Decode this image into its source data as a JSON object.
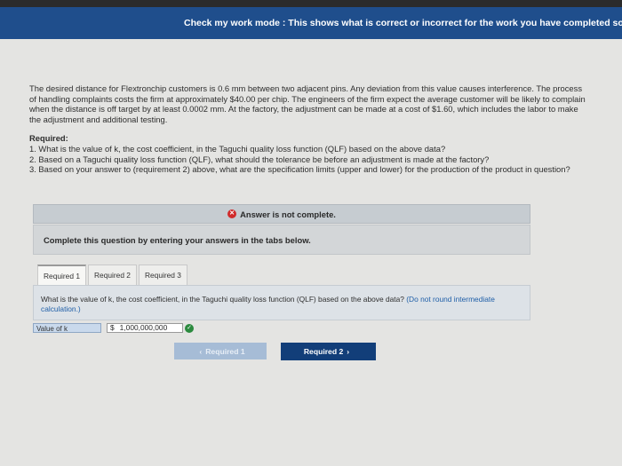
{
  "banner": {
    "text": "Check my work mode : This shows what is correct or incorrect for the work you have completed so far."
  },
  "problem": {
    "paragraph": "The desired distance for Flextronchip customers is 0.6 mm between two adjacent pins. Any deviation from this value causes interference. The process of handling complaints costs the firm at approximately $40.00 per chip. The engineers of the firm expect the average customer will be likely to complain when the distance is off target by at least 0.0002 mm. At the factory, the adjustment can be made at a cost of $1.60, which includes the labor to make the adjustment and additional testing.",
    "required_heading": "Required:",
    "requirements": [
      "1. What is the value of k, the cost coefficient, in the Taguchi quality loss function (QLF) based on the above data?",
      "2. Based on a Taguchi quality loss function (QLF), what should the tolerance be before an adjustment is made at the factory?",
      "3. Based on your answer to (requirement 2) above, what are the specification limits (upper and lower) for the production of the product in question?"
    ]
  },
  "status": {
    "text": "Answer is not complete.",
    "icon": "x-circle-icon",
    "color": "#d02b2b"
  },
  "instruction": {
    "text": "Complete this question by entering your answers in the tabs below."
  },
  "tabs": [
    {
      "label": "Required 1",
      "active": true
    },
    {
      "label": "Required 2",
      "active": false
    },
    {
      "label": "Required 3",
      "active": false
    }
  ],
  "question": {
    "text": "What is the value of k, the cost coefficient, in the Taguchi quality loss function (QLF) based on the above data?",
    "note": "(Do not round intermediate calculation.)"
  },
  "answer": {
    "label": "Value of k",
    "currency": "$",
    "value": "1,000,000,000",
    "status_icon": "check-circle-icon",
    "status_color": "#2b8a3e"
  },
  "navigation": {
    "prev_label": "Required 1",
    "next_label": "Required 2"
  }
}
